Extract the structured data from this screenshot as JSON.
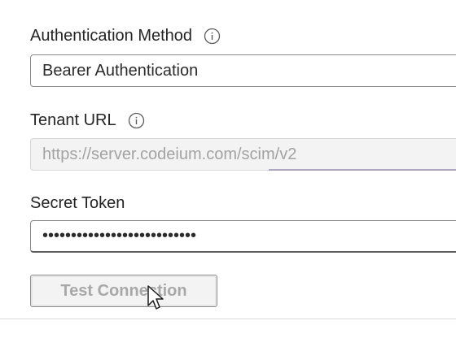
{
  "auth_method": {
    "label": "Authentication Method",
    "icon": "info-icon",
    "value": "Bearer Authentication"
  },
  "tenant_url": {
    "label": "Tenant URL",
    "icon": "info-icon",
    "placeholder": "https://server.codeium.com/scim/v2"
  },
  "secret_token": {
    "label": "Secret Token",
    "masked_value": "•••••••••••••••••••••••••••"
  },
  "test_button": {
    "label": "Test Connection"
  },
  "colors": {
    "disabled_text": "#a3a3a3",
    "accent_line": "#7a6a9a"
  }
}
